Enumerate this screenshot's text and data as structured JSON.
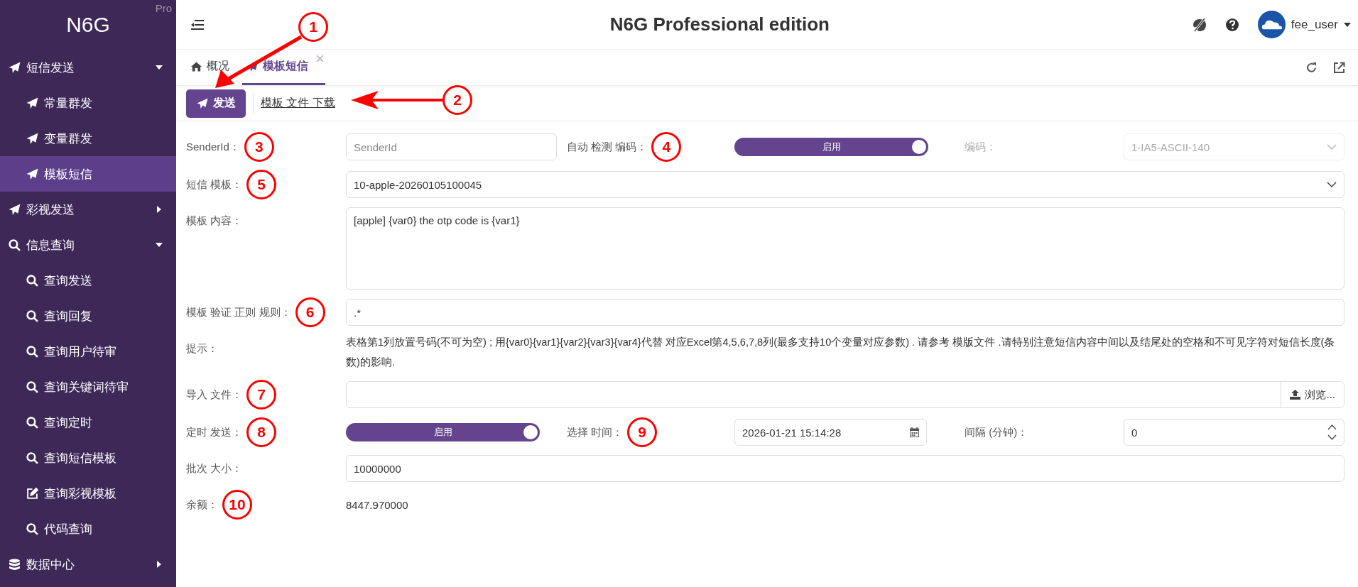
{
  "sidebar": {
    "brand": "N6G",
    "edition": "Pro",
    "items": [
      {
        "label": "短信发送",
        "selected": false,
        "expanded": true,
        "children": [
          {
            "label": "常量群发",
            "selected": false
          },
          {
            "label": "变量群发",
            "selected": false
          },
          {
            "label": "模板短信",
            "selected": true
          }
        ]
      },
      {
        "label": "彩视发送",
        "selected": false,
        "expanded": false
      },
      {
        "label": "信息查询",
        "selected": false,
        "expanded": true,
        "children": [
          {
            "label": "查询发送",
            "selected": false
          },
          {
            "label": "查询回复",
            "selected": false
          },
          {
            "label": "查询用户待审",
            "selected": false
          },
          {
            "label": "查询关键词待审",
            "selected": false
          },
          {
            "label": "查询定时",
            "selected": false
          },
          {
            "label": "查询短信模板",
            "selected": false
          },
          {
            "label": "查询彩视模板",
            "selected": false
          },
          {
            "label": "代码查询",
            "selected": false
          }
        ]
      },
      {
        "label": "数据中心",
        "selected": false,
        "expanded": false
      }
    ]
  },
  "header": {
    "title": "N6G Professional edition",
    "user": "fee_user"
  },
  "tabs": [
    {
      "label": "概况",
      "selected": false,
      "closable": false
    },
    {
      "label": "模板短信",
      "selected": true,
      "closable": true
    }
  ],
  "toolbar": {
    "send_button": {
      "label": "发送",
      "callout": "1"
    },
    "template_link": {
      "label": "模板 文件 下载",
      "callout": "2"
    }
  },
  "form": {
    "rows": [
      [
        {
          "kind": "text",
          "label": "SenderId：",
          "placeholder": "SenderId",
          "callout": "3"
        },
        {
          "kind": "switch",
          "label": "自动 检测 编码：",
          "text": "启用",
          "on": true,
          "callout": "4"
        },
        {
          "kind": "select",
          "label": "编码：",
          "value": "1-IA5-ASCII-140",
          "disabled": true
        }
      ],
      [
        {
          "kind": "select",
          "label": "短信 模板：",
          "value": "10-apple-20260105100045",
          "disabled": false,
          "callout": "5"
        }
      ],
      [
        {
          "kind": "textarea",
          "label": "模板 内容：",
          "value": "[apple] {var0} the otp code is {var1}"
        }
      ],
      [
        {
          "kind": "text",
          "label": "模板 验证 正则 规则：",
          "value": ".*",
          "callout": "6"
        }
      ],
      [
        {
          "kind": "note",
          "label": "提示：",
          "value": "表格第1列放置号码(不可为空) ; 用{var0}{var1}{var2}{var3}{var4}代替 对应Excel第4,5,6,7,8列(最多支持10个变量对应参数) . 请参考 模版文件 .请特别注意短信内容中间以及结尾处的空格和不可见字符对短信长度(条数)的影响."
        }
      ],
      [
        {
          "kind": "file",
          "label": "导入 文件：",
          "button": "浏览...",
          "callout": "7"
        }
      ],
      [
        {
          "kind": "switch",
          "label": "定时 发送：",
          "text": "启用",
          "on": true,
          "callout": "8"
        },
        {
          "kind": "date",
          "label": "选择 时间：",
          "value": "2026-01-21 15:14:28",
          "callout": "9"
        },
        {
          "kind": "number",
          "label": "间隔 (分钟)：",
          "value": "0"
        }
      ],
      [
        {
          "kind": "text",
          "label": "批次 大小：",
          "value": "10000000"
        }
      ],
      [
        {
          "kind": "value",
          "label": "余额：",
          "value": "8447.970000",
          "callout": "10"
        }
      ]
    ]
  }
}
